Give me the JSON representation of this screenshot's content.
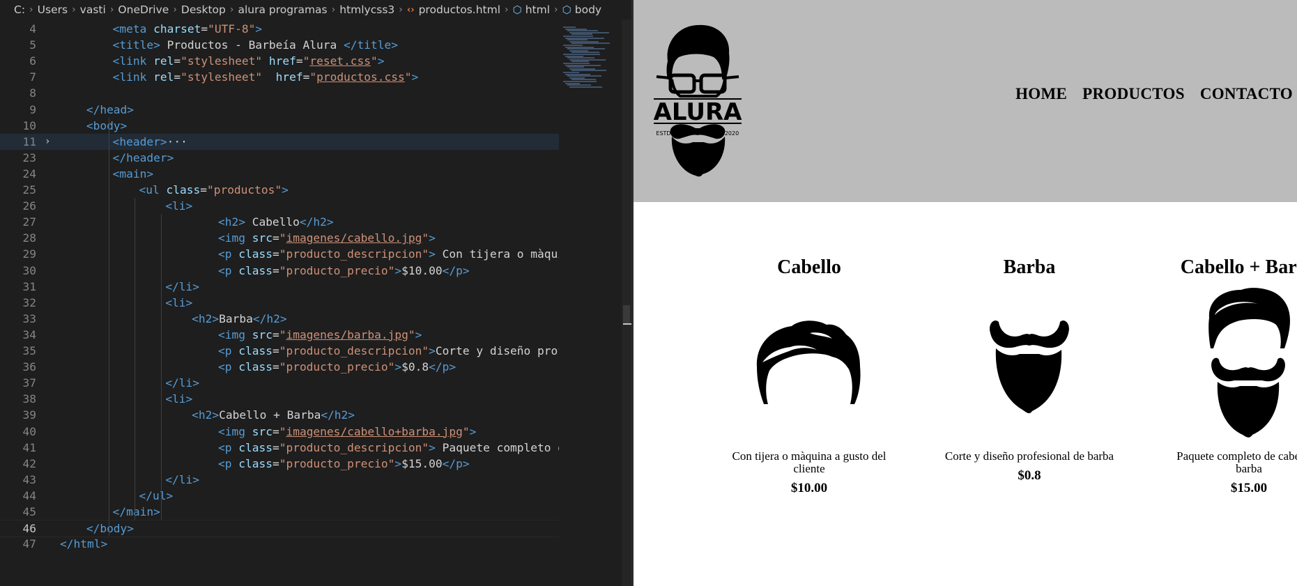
{
  "breadcrumb": {
    "items": [
      "C:",
      "Users",
      "vasti",
      "OneDrive",
      "Desktop",
      "alura programas",
      "htmlycss3"
    ],
    "file": "productos.html",
    "tags": [
      "html",
      "body"
    ]
  },
  "code_lines": [
    {
      "n": "4",
      "tokens": [
        [
          "t",
          "<meta "
        ],
        [
          "a",
          "charset"
        ],
        [
          "x",
          "="
        ],
        [
          "s",
          "\"UTF-8\""
        ],
        [
          "t",
          ">"
        ]
      ]
    },
    {
      "n": "5",
      "tokens": [
        [
          "t",
          "<title>"
        ],
        [
          "x",
          " Productos - Barbeía Alura "
        ],
        [
          "t",
          "</title>"
        ]
      ]
    },
    {
      "n": "6",
      "tokens": [
        [
          "t",
          "<link "
        ],
        [
          "a",
          "rel"
        ],
        [
          "x",
          "="
        ],
        [
          "s",
          "\"stylesheet\""
        ],
        [
          "x",
          " "
        ],
        [
          "a",
          "href"
        ],
        [
          "x",
          "="
        ],
        [
          "s",
          "\""
        ],
        [
          "u",
          "reset.css"
        ],
        [
          "s",
          "\""
        ],
        [
          "t",
          ">"
        ]
      ]
    },
    {
      "n": "7",
      "tokens": [
        [
          "t",
          "<link "
        ],
        [
          "a",
          "rel"
        ],
        [
          "x",
          "="
        ],
        [
          "s",
          "\"stylesheet\""
        ],
        [
          "x",
          "  "
        ],
        [
          "a",
          "href"
        ],
        [
          "x",
          "="
        ],
        [
          "s",
          "\""
        ],
        [
          "u",
          "productos.css"
        ],
        [
          "s",
          "\""
        ],
        [
          "t",
          ">"
        ]
      ]
    },
    {
      "n": "8",
      "tokens": []
    },
    {
      "n": "9",
      "tokens": [
        [
          "t",
          "</head>"
        ]
      ]
    },
    {
      "n": "10",
      "tokens": [
        [
          "t",
          "<body>"
        ]
      ]
    },
    {
      "n": "11",
      "tokens": [
        [
          "t",
          "<header>"
        ],
        [
          "x",
          "···"
        ]
      ]
    },
    {
      "n": "23",
      "tokens": [
        [
          "t",
          "</header>"
        ]
      ]
    },
    {
      "n": "24",
      "tokens": [
        [
          "t",
          "<main>"
        ]
      ]
    },
    {
      "n": "25",
      "tokens": [
        [
          "t",
          "<ul "
        ],
        [
          "a",
          "class"
        ],
        [
          "x",
          "="
        ],
        [
          "s",
          "\"productos\""
        ],
        [
          "t",
          ">"
        ]
      ]
    },
    {
      "n": "26",
      "tokens": [
        [
          "t",
          "<li>"
        ]
      ]
    },
    {
      "n": "27",
      "tokens": [
        [
          "t",
          "<h2>"
        ],
        [
          "x",
          " Cabello"
        ],
        [
          "t",
          "</h2>"
        ]
      ]
    },
    {
      "n": "28",
      "tokens": [
        [
          "t",
          "<img "
        ],
        [
          "a",
          "src"
        ],
        [
          "x",
          "="
        ],
        [
          "s",
          "\""
        ],
        [
          "u",
          "imagenes/cabello.jpg"
        ],
        [
          "s",
          "\""
        ],
        [
          "t",
          ">"
        ]
      ]
    },
    {
      "n": "29",
      "tokens": [
        [
          "t",
          "<p "
        ],
        [
          "a",
          "class"
        ],
        [
          "x",
          "="
        ],
        [
          "s",
          "\"producto_descripcion\""
        ],
        [
          "t",
          ">"
        ],
        [
          "x",
          " Con tijera o màquina"
        ]
      ]
    },
    {
      "n": "30",
      "tokens": [
        [
          "t",
          "<p "
        ],
        [
          "a",
          "class"
        ],
        [
          "x",
          "="
        ],
        [
          "s",
          "\"producto_precio\""
        ],
        [
          "t",
          ">"
        ],
        [
          "x",
          "$10.00"
        ],
        [
          "t",
          "</p>"
        ]
      ]
    },
    {
      "n": "31",
      "tokens": [
        [
          "t",
          "</li>"
        ]
      ]
    },
    {
      "n": "32",
      "tokens": [
        [
          "t",
          "<li>"
        ]
      ]
    },
    {
      "n": "33",
      "tokens": [
        [
          "t",
          "<h2>"
        ],
        [
          "x",
          "Barba"
        ],
        [
          "t",
          "</h2>"
        ]
      ]
    },
    {
      "n": "34",
      "tokens": [
        [
          "t",
          "<img "
        ],
        [
          "a",
          "src"
        ],
        [
          "x",
          "="
        ],
        [
          "s",
          "\""
        ],
        [
          "u",
          "imagenes/barba.jpg"
        ],
        [
          "s",
          "\""
        ],
        [
          "t",
          ">"
        ]
      ]
    },
    {
      "n": "35",
      "tokens": [
        [
          "t",
          "<p "
        ],
        [
          "a",
          "class"
        ],
        [
          "x",
          "="
        ],
        [
          "s",
          "\"producto_descripcion\""
        ],
        [
          "t",
          ">"
        ],
        [
          "x",
          "Corte y diseño profesi"
        ]
      ]
    },
    {
      "n": "36",
      "tokens": [
        [
          "t",
          "<p "
        ],
        [
          "a",
          "class"
        ],
        [
          "x",
          "="
        ],
        [
          "s",
          "\"producto_precio\""
        ],
        [
          "t",
          ">"
        ],
        [
          "x",
          "$0.8"
        ],
        [
          "t",
          "</p>"
        ]
      ]
    },
    {
      "n": "37",
      "tokens": [
        [
          "t",
          "</li>"
        ]
      ]
    },
    {
      "n": "38",
      "tokens": [
        [
          "t",
          "<li>"
        ]
      ]
    },
    {
      "n": "39",
      "tokens": [
        [
          "t",
          "<h2>"
        ],
        [
          "x",
          "Cabello + Barba"
        ],
        [
          "t",
          "</h2>"
        ]
      ]
    },
    {
      "n": "40",
      "tokens": [
        [
          "t",
          "<img "
        ],
        [
          "a",
          "src"
        ],
        [
          "x",
          "="
        ],
        [
          "s",
          "\""
        ],
        [
          "u",
          "imagenes/cabello+barba.jpg"
        ],
        [
          "s",
          "\""
        ],
        [
          "t",
          ">"
        ]
      ]
    },
    {
      "n": "41",
      "tokens": [
        [
          "t",
          "<p "
        ],
        [
          "a",
          "class"
        ],
        [
          "x",
          "="
        ],
        [
          "s",
          "\"producto_descripcion\""
        ],
        [
          "t",
          ">"
        ],
        [
          "x",
          " Paquete completo de c"
        ]
      ]
    },
    {
      "n": "42",
      "tokens": [
        [
          "t",
          "<p "
        ],
        [
          "a",
          "class"
        ],
        [
          "x",
          "="
        ],
        [
          "s",
          "\"producto_precio\""
        ],
        [
          "t",
          ">"
        ],
        [
          "x",
          "$15.00"
        ],
        [
          "t",
          "</p>"
        ]
      ]
    },
    {
      "n": "43",
      "tokens": [
        [
          "t",
          "</li>"
        ]
      ]
    },
    {
      "n": "44",
      "tokens": [
        [
          "t",
          "</ul>"
        ]
      ]
    },
    {
      "n": "45",
      "tokens": [
        [
          "t",
          "</main>"
        ]
      ]
    },
    {
      "n": "46",
      "tokens": [
        [
          "t",
          "</body>"
        ]
      ]
    },
    {
      "n": "47",
      "tokens": [
        [
          "t",
          "</html>"
        ]
      ]
    }
  ],
  "site": {
    "logo_text": "ALURA",
    "logo_left": "ESTD",
    "logo_right": "2020",
    "nav": [
      "HOME",
      "PRODUCTOS",
      "CONTACTO"
    ],
    "products": [
      {
        "title": "Cabello",
        "description": "Con tijera o màquina a gusto del cliente",
        "price": "$10.00",
        "icon": "hair-icon"
      },
      {
        "title": "Barba",
        "description": "Corte y diseño profesional de barba",
        "price": "$0.8",
        "icon": "beard-icon"
      },
      {
        "title": "Cabello + Barba",
        "description": "Paquete completo de cabello y barba",
        "price": "$15.00",
        "icon": "hair-beard-icon"
      }
    ]
  }
}
